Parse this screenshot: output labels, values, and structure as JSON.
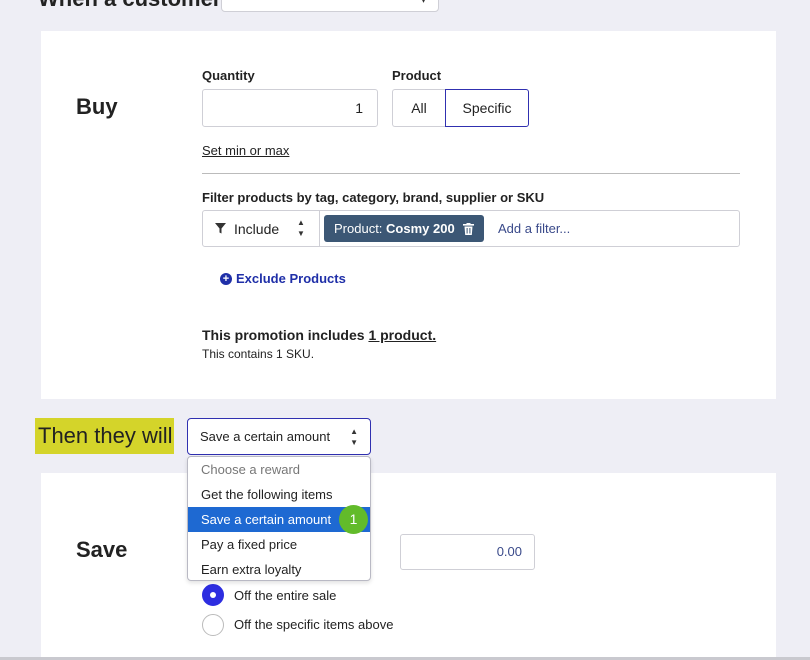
{
  "top": {
    "label": "When a customer"
  },
  "buy": {
    "title": "Buy",
    "quantity_label": "Quantity",
    "quantity_value": "1",
    "product_label": "Product",
    "product_options": [
      "All",
      "Specific"
    ],
    "product_selected": "Specific",
    "set_min_max": "Set min or max",
    "filter_label": "Filter products by tag, category, brand, supplier or SKU",
    "filter_mode": "Include",
    "chip_prefix": "Product:",
    "chip_value": "Cosmy 200",
    "add_filter_placeholder": "Add a filter...",
    "exclude_link": "Exclude Products",
    "summary_prefix": "This promotion includes",
    "summary_link": "1 product.",
    "summary_sub": "This contains 1 SKU."
  },
  "then": {
    "label": "Then they will",
    "reward_selected": "Save a certain amount",
    "dropdown_items": [
      "Choose a reward",
      "Get the following items",
      "Save a certain amount",
      "Pay a fixed price",
      "Earn extra loyalty"
    ],
    "badge": "1"
  },
  "save": {
    "title": "Save",
    "amount_value": "0.00",
    "radio_options": [
      "Off the entire sale",
      "Off the specific items above"
    ],
    "radio_selected": "Off the entire sale"
  },
  "colors": {
    "accent": "#3030b0",
    "chip_bg": "#3c5775",
    "highlight": "#d4d42a",
    "selected_item": "#1e69d2",
    "badge": "#62bb2a",
    "link": "#1f2fa8"
  }
}
